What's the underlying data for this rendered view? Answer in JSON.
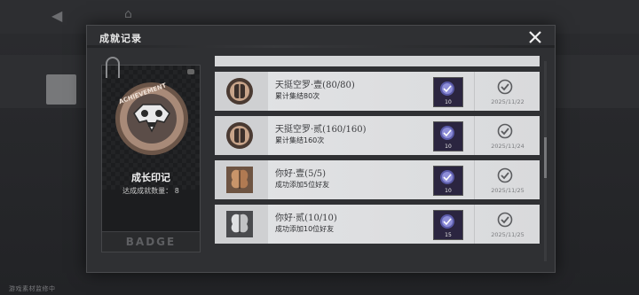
{
  "background": {
    "watermark": "游戏素材监修中"
  },
  "modal": {
    "title": "成就记录"
  },
  "badge": {
    "name": "成长印记",
    "count_label": "达成成就数量：",
    "count": "8",
    "footer_label": "BADGE",
    "medal_text": "ACHIEVEMENT"
  },
  "achievements": [
    {
      "title": "天挺空罗·壹(80/80)",
      "description": "累计集结80次",
      "reward_qty": "10",
      "date": "2025/11/22",
      "icon": "mirror-icon"
    },
    {
      "title": "天挺空罗·贰(160/160)",
      "description": "累计集结160次",
      "reward_qty": "10",
      "date": "2025/11/24",
      "icon": "mirror-icon"
    },
    {
      "title": "你好·壹(5/5)",
      "description": "成功添加5位好友",
      "reward_qty": "10",
      "date": "2025/11/25",
      "icon": "butterfly-icon"
    },
    {
      "title": "你好·贰(10/10)",
      "description": "成功添加10位好友",
      "reward_qty": "15",
      "date": "2025/11/25",
      "icon": "butterfly-icon"
    }
  ],
  "colors": {
    "modal_bg": "#2f3033",
    "row_bg": "#e2e3e5",
    "reward_bg": "#2b2540"
  }
}
